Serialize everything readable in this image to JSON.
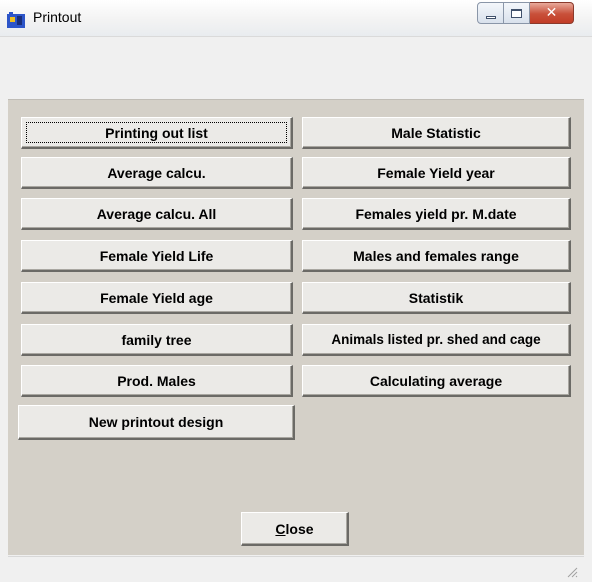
{
  "window": {
    "title": "Printout",
    "accent_close": "#c8503a"
  },
  "left_buttons": [
    "Printing out list",
    "Average calcu.",
    "Average calcu. All",
    "Female Yield Life",
    "Female Yield age",
    "family tree",
    "Prod. Males",
    "New printout design"
  ],
  "right_buttons": [
    "Male Statistic",
    "Female Yield year",
    "Females yield pr. M.date",
    "Males and females range",
    "Statistik",
    "Animals listed pr. shed and cage",
    "Calculating average"
  ],
  "close_button": {
    "mnemonic": "C",
    "rest": "lose"
  },
  "icons": [
    "app-icon",
    "minimize-icon",
    "maximize-icon",
    "close-icon",
    "resize-grip-icon"
  ]
}
